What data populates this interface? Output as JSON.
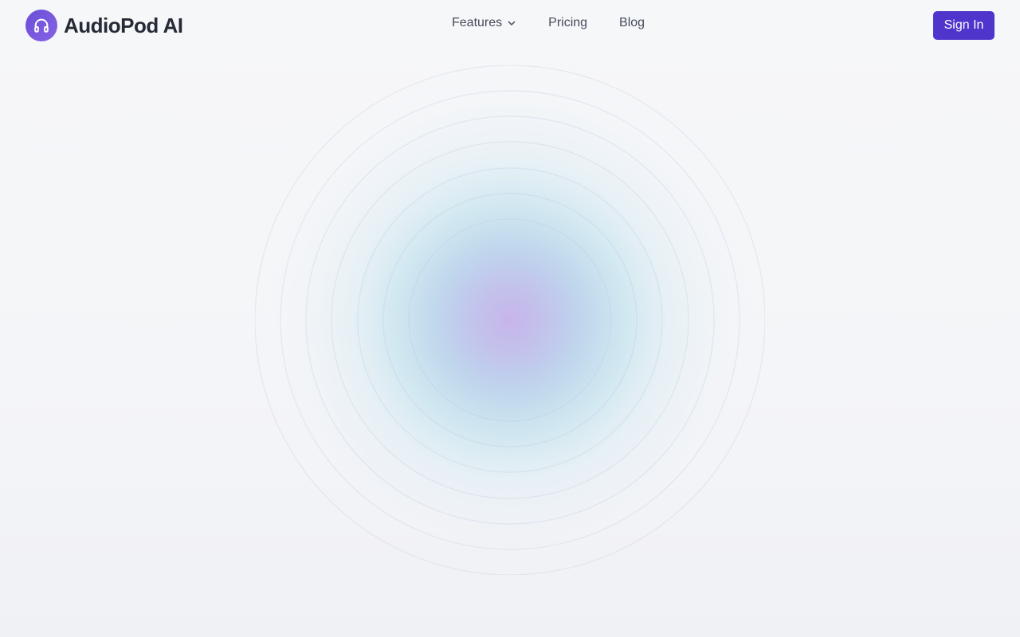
{
  "brand": {
    "name": "AudioPod AI",
    "logo_icon": "headphones-icon",
    "logo_color": "#6a4fd8"
  },
  "nav": {
    "items": [
      {
        "label": "Features",
        "has_dropdown": true,
        "icon": "chevron-down-icon"
      },
      {
        "label": "Pricing"
      },
      {
        "label": "Blog"
      }
    ]
  },
  "auth": {
    "sign_in_label": "Sign In",
    "button_color": "#4f35cc"
  },
  "hero": {
    "visual": "concentric-audio-rings",
    "ring_colors": [
      "#c7b7ec",
      "#b6d3ec",
      "#c5e3ee",
      "#e4eef4"
    ]
  }
}
